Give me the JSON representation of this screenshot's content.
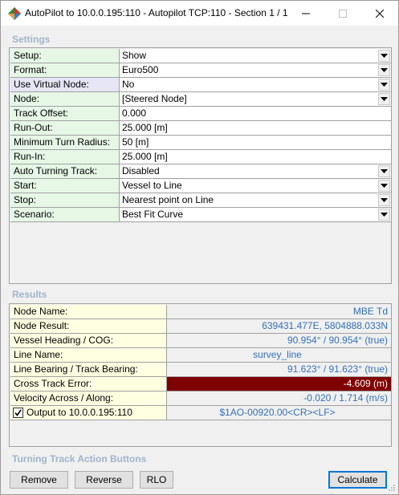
{
  "window": {
    "title": "AutoPilot to 10.0.0.195:110 - Autopilot TCP:110 - Section 1 / 1"
  },
  "settings": {
    "label": "Settings",
    "rows": [
      {
        "label": "Setup:",
        "value": "Show",
        "dropdown": true
      },
      {
        "label": "Format:",
        "value": "Euro500",
        "dropdown": true
      },
      {
        "label": "Use Virtual Node:",
        "value": "No",
        "dropdown": true
      },
      {
        "label": "Node:",
        "value": "[Steered Node]",
        "dropdown": true
      },
      {
        "label": "Track Offset:",
        "value": "0.000",
        "dropdown": false
      },
      {
        "label": "Run-Out:",
        "value": "25.000 [m]",
        "dropdown": false
      },
      {
        "label": "Minimum Turn Radius:",
        "value": "50 [m]",
        "dropdown": false
      },
      {
        "label": "Run-In:",
        "value": "25.000 [m]",
        "dropdown": false
      },
      {
        "label": "Auto Turning Track:",
        "value": "Disabled",
        "dropdown": true
      },
      {
        "label": "Start:",
        "value": "Vessel to Line",
        "dropdown": true
      },
      {
        "label": "Stop:",
        "value": "Nearest point on Line",
        "dropdown": true
      },
      {
        "label": "Scenario:",
        "value": "Best Fit Curve",
        "dropdown": true
      }
    ]
  },
  "results": {
    "label": "Results",
    "rows": [
      {
        "label": "Node Name:",
        "value": "MBE Td"
      },
      {
        "label": "Node Result:",
        "value": "639431.477E, 5804888.033N"
      },
      {
        "label": "Vessel Heading / COG:",
        "value": "90.954° / 90.954° (true)"
      },
      {
        "label": "Line Name:",
        "value": "survey_line"
      },
      {
        "label": "Line Bearing / Track Bearing:",
        "value": "91.623° / 91.623° (true)"
      },
      {
        "label": "Cross Track Error:",
        "value": "-4.609 (m)"
      },
      {
        "label": "Velocity Across / Along:",
        "value": "-0.020 / 1.714 (m/s)"
      },
      {
        "label": "Output to 10.0.0.195:110",
        "value": "$1AO-00920.00<CR><LF>",
        "checked": true
      }
    ]
  },
  "actions": {
    "label": "Turning Track Action Buttons",
    "remove": "Remove",
    "reverse": "Reverse",
    "rlo": "RLO",
    "calculate": "Calculate"
  },
  "colors": {
    "settings_label_bg": "#e6f7e6",
    "virtual_label_bg": "#e5e5f5",
    "results_label_bg": "#ffffe1",
    "result_value_text": "#3370b8",
    "error_bg": "#7f0000",
    "section_label": "#a0b4cc"
  }
}
